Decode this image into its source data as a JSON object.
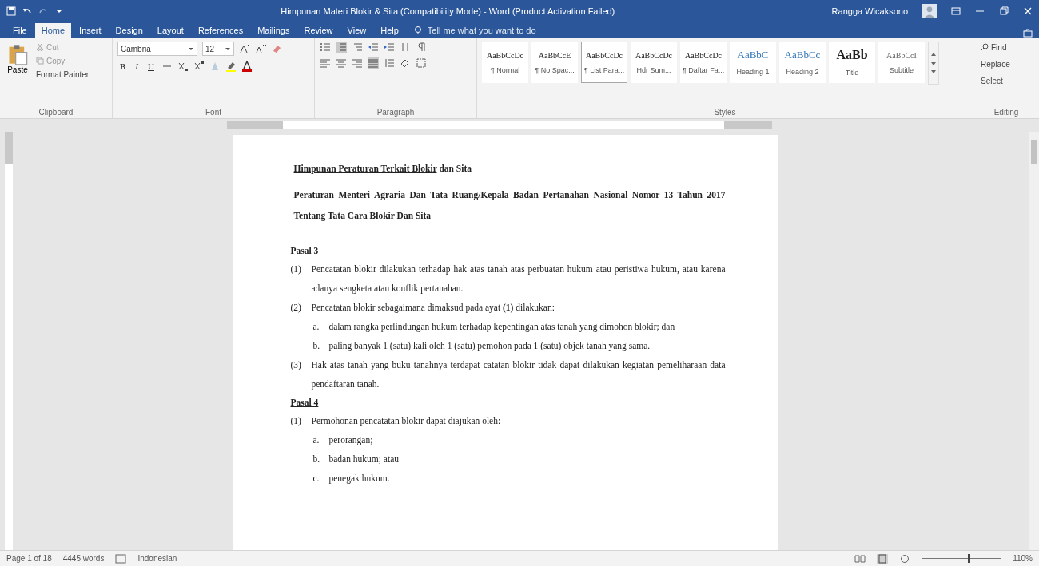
{
  "window": {
    "title": "Himpunan Materi Blokir & Sita (Compatibility Mode) - Word (Product Activation Failed)",
    "user": "Rangga Wicaksono"
  },
  "tabs": [
    {
      "label": "File",
      "selected": false
    },
    {
      "label": "Home",
      "selected": true
    },
    {
      "label": "Insert",
      "selected": false
    },
    {
      "label": "Design",
      "selected": false
    },
    {
      "label": "Layout",
      "selected": false
    },
    {
      "label": "References",
      "selected": false
    },
    {
      "label": "Mailings",
      "selected": false
    },
    {
      "label": "Review",
      "selected": false
    },
    {
      "label": "View",
      "selected": false
    },
    {
      "label": "Help",
      "selected": false
    }
  ],
  "tell_me": {
    "placeholder": "Tell me what you want to do"
  },
  "ribbon": {
    "clipboard": {
      "paste": "Paste",
      "cut": "Cut",
      "copy": "Copy",
      "format_painter": "Format Painter",
      "label": "Clipboard"
    },
    "font": {
      "family": "Cambria",
      "size": "12",
      "format_buttons": [
        "B",
        "I",
        "U"
      ],
      "label": "Font"
    },
    "paragraph": {
      "label": "Paragraph"
    },
    "styles": {
      "items": [
        {
          "sample": "AaBbCcDc",
          "name": "¶ Normal",
          "selected": false
        },
        {
          "sample": "AaBbCcE",
          "name": "¶ No Spac...",
          "selected": false
        },
        {
          "sample": "AaBbCcDc",
          "name": "¶ List Para...",
          "selected": true
        },
        {
          "sample": "AaBbCcDc",
          "name": "Hdr Sum...",
          "selected": false
        },
        {
          "sample": "AaBbCcDc",
          "name": "¶ Daftar Fa...",
          "selected": false
        },
        {
          "sample": "AaBbC",
          "name": "Heading 1",
          "selected": false
        },
        {
          "sample": "AaBbCc",
          "name": "Heading 2",
          "selected": false
        },
        {
          "sample": "AaBb",
          "name": "Title",
          "selected": false
        },
        {
          "sample": "AaBbCcI",
          "name": "Subtitle",
          "selected": false
        }
      ],
      "label": "Styles"
    },
    "editing": {
      "find": "Find",
      "replace": "Replace",
      "select": "Select",
      "label": "Editing"
    }
  },
  "document": {
    "title_underlined": "Himpunan Peraturan Terkait Blokir",
    "title_rest": "dan Sita",
    "paragraphs": [
      {
        "kind": "heading",
        "text": "Peraturan Menteri Agraria Dan Tata Ruang/Kepala Badan Pertanahan Nasional Nomor 13 Tahun 2017 Tentang Tata Cara Blokir Dan Sita"
      },
      {
        "kind": "pasal",
        "text": "Pasal 3"
      },
      {
        "kind": "ayat",
        "number": "(1)",
        "text": "Pencatatan blokir dilakukan terhadap hak atas tanah atas perbuatan hukum atau peristiwa hukum, atau karena adanya sengketa atau konflik pertanahan."
      },
      {
        "kind": "ayat",
        "number": "(2)",
        "text": "Pencatatan blokir sebagaimana dimaksud pada ayat **(1)** dilakukan:"
      },
      {
        "kind": "item",
        "number": "a.",
        "text": "dalam rangka perlindungan hukum terhadap kepentingan atas tanah yang dimohon blokir; dan"
      },
      {
        "kind": "item",
        "number": "b.",
        "text": "paling banyak 1 (satu) kali oleh 1 (satu) pemohon pada 1 (satu) objek tanah yang sama."
      },
      {
        "kind": "ayat",
        "number": "(3)",
        "text": "Hak atas tanah yang buku tanahnya terdapat catatan blokir tidak dapat dilakukan kegiatan pemeliharaan data pendaftaran tanah."
      },
      {
        "kind": "pasal",
        "text": "Pasal 4"
      },
      {
        "kind": "ayat",
        "number": "(1)",
        "text": "Permohonan pencatatan blokir dapat diajukan oleh:"
      },
      {
        "kind": "item",
        "number": "a.",
        "text": "perorangan;"
      },
      {
        "kind": "item",
        "number": "b.",
        "text": "badan hukum; atau"
      },
      {
        "kind": "item",
        "number": "c.",
        "text": "penegak hukum."
      }
    ]
  },
  "status_bar": {
    "page": "Page 1 of 18",
    "words": "4445 words",
    "language": "Indonesian",
    "zoom_slider": {
      "level": 0.58
    },
    "zoom": "110%"
  }
}
